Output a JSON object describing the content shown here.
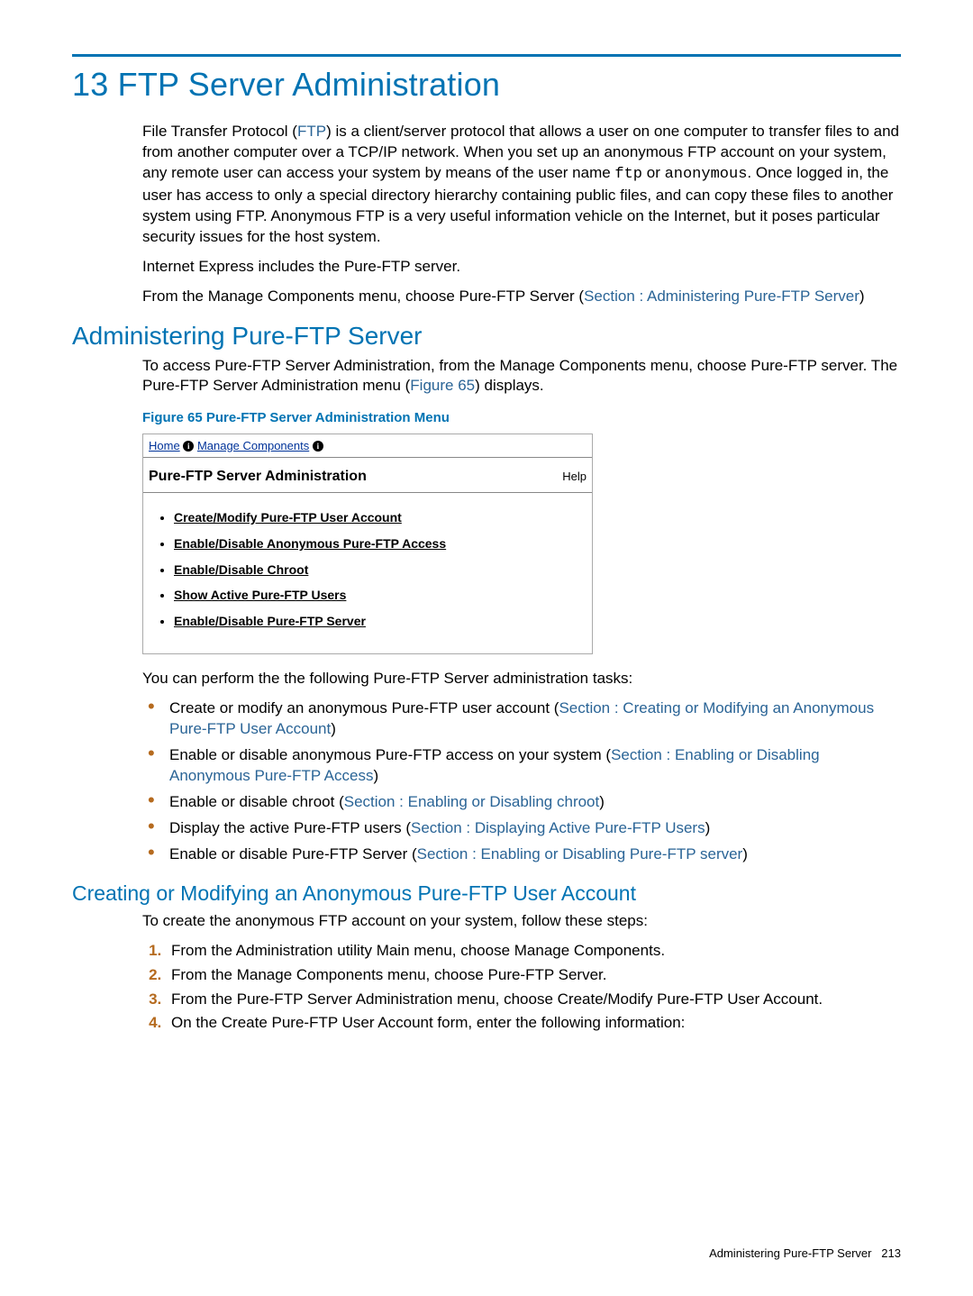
{
  "chapter": {
    "number": "13",
    "title": "FTP Server Administration"
  },
  "intro": {
    "p1_a": "File Transfer Protocol (",
    "p1_ftp": "FTP",
    "p1_b": ") is a client/server protocol that allows a user on one computer to transfer files to and from another computer over a TCP/IP network. When you set up an anonymous FTP account on your system, any remote user can access your system by means of the user name ",
    "p1_c_code": "ftp",
    "p1_d": " or ",
    "p1_e_code": "anonymous",
    "p1_f": ". Once logged in, the user has access to only a special directory hierarchy containing public files, and can copy these files to another system using FTP. Anonymous FTP is a very useful information vehicle on the Internet, but it poses particular security issues for the host system.",
    "p2": "Internet Express includes the Pure-FTP server.",
    "p3_a": "From the Manage Components menu, choose Pure-FTP Server (",
    "p3_link": "Section : Administering Pure-FTP Server",
    "p3_b": ")"
  },
  "sec1": {
    "title": "Administering Pure-FTP Server",
    "p1_a": "To access Pure-FTP Server Administration, from the Manage Components menu, choose Pure-FTP server. The Pure-FTP Server Administration menu (",
    "p1_link": "Figure 65",
    "p1_b": ") displays."
  },
  "figure": {
    "caption": "Figure 65 Pure-FTP Server Administration Menu",
    "crumb_home": "Home",
    "crumb_manage": "Manage Components",
    "title": "Pure-FTP Server Administration",
    "help": "Help",
    "items": [
      "Create/Modify Pure-FTP User Account",
      "Enable/Disable Anonymous Pure-FTP Access",
      "Enable/Disable Chroot",
      "Show Active Pure-FTP Users",
      "Enable/Disable Pure-FTP Server"
    ]
  },
  "tasks": {
    "lead": "You can perform the the following Pure-FTP Server administration tasks:",
    "items": [
      {
        "a": "Create or modify an anonymous Pure-FTP user account (",
        "link": "Section : Creating or Modifying an Anonymous Pure-FTP User Account",
        "b": ")"
      },
      {
        "a": "Enable or disable anonymous Pure-FTP access on your system (",
        "link": "Section : Enabling or Disabling Anonymous Pure-FTP Access",
        "b": ")"
      },
      {
        "a": "Enable or disable chroot (",
        "link": "Section : Enabling or Disabling chroot",
        "b": ")"
      },
      {
        "a": "Display the active Pure-FTP users (",
        "link": "Section : Displaying Active Pure-FTP Users",
        "b": ")"
      },
      {
        "a": "Enable or disable Pure-FTP Server (",
        "link": "Section : Enabling or Disabling Pure-FTP server",
        "b": ")"
      }
    ]
  },
  "sec2": {
    "title": "Creating or Modifying an Anonymous Pure-FTP User Account",
    "lead": "To create the anonymous FTP account on your system, follow these steps:",
    "steps": [
      "From the Administration utility Main menu, choose Manage Components.",
      "From the Manage Components menu, choose Pure-FTP Server.",
      "From the Pure-FTP Server Administration menu, choose Create/Modify Pure-FTP User Account.",
      "On the Create Pure-FTP User Account form, enter the following information:"
    ]
  },
  "footer": {
    "text": "Administering Pure-FTP Server",
    "page": "213"
  }
}
